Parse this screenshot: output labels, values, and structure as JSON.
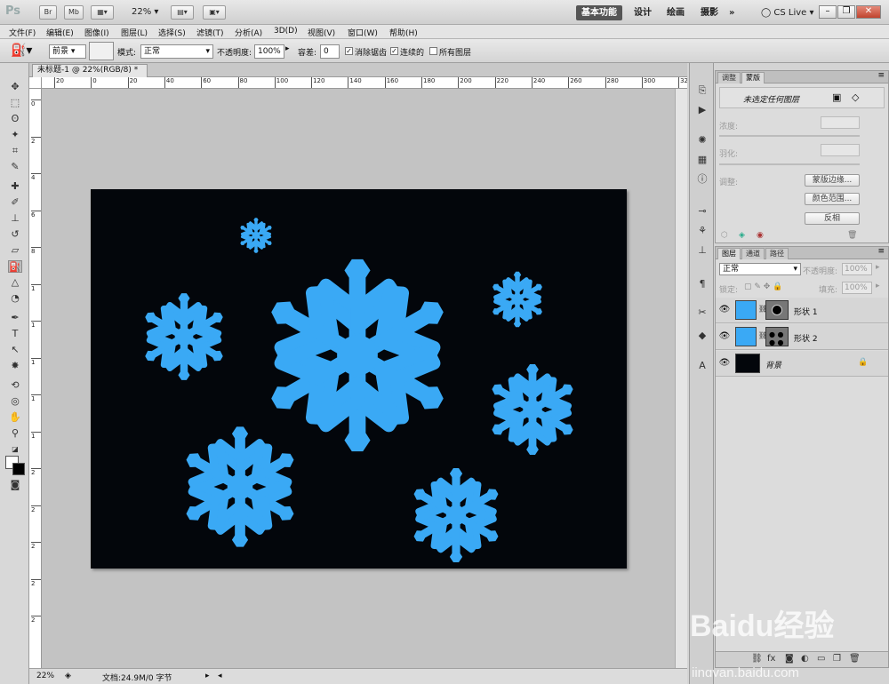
{
  "titlebar": {
    "app_logo": "Ps",
    "br_btn": "Br",
    "mb_btn": "Mb",
    "zoom": "22%",
    "workspaces": [
      "基本功能",
      "设计",
      "绘画",
      "摄影",
      "»"
    ],
    "cs_live": "CS Live",
    "window_controls": [
      "–",
      "❐",
      "✕"
    ]
  },
  "menu": [
    "文件(F)",
    "编辑(E)",
    "图像(I)",
    "图层(L)",
    "选择(S)",
    "滤镜(T)",
    "分析(A)",
    "3D(D)",
    "视图(V)",
    "窗口(W)",
    "帮助(H)"
  ],
  "options": {
    "fill_source": "前景",
    "mode_label": "模式:",
    "mode_value": "正常",
    "opacity_label": "不透明度:",
    "opacity_value": "100%",
    "tolerance_label": "容差:",
    "tolerance_value": "0",
    "antialias_label": "消除锯齿",
    "contiguous_label": "连续的",
    "all_layers_label": "所有图层"
  },
  "document": {
    "tab_title": "未标题-1 @ 22%(RGB/8) *",
    "ruler_top_labels": [
      "20",
      "0",
      "20",
      "40",
      "60",
      "80",
      "100",
      "120",
      "140",
      "160",
      "180",
      "200",
      "220",
      "240",
      "260",
      "280",
      "300",
      "32"
    ],
    "ruler_left_labels": [
      "0",
      "2",
      "4",
      "6",
      "8",
      "1",
      "1",
      "1",
      "1",
      "1",
      "2",
      "2",
      "2",
      "2",
      "2"
    ],
    "zoom": "22%",
    "doc_info": "文档:24.9M/0 字节"
  },
  "masks_panel": {
    "tabs": [
      "调整",
      "蒙版"
    ],
    "title": "未选定任何图层",
    "density_label": "浓度:",
    "feather_label": "羽化:",
    "refine_label": "调整:",
    "buttons": [
      "蒙版边缘...",
      "颜色范围...",
      "反相"
    ]
  },
  "layers_panel": {
    "tabs": [
      "图层",
      "通道",
      "路径"
    ],
    "blend_mode": "正常",
    "opacity_label": "不透明度:",
    "opacity_value": "100%",
    "lock_label": "锁定:",
    "fill_label": "填充:",
    "fill_value": "100%",
    "layers": [
      {
        "name": "形状 1",
        "thumb_color": "#3aa9f5"
      },
      {
        "name": "形状 2",
        "thumb_color": "#3aa9f5"
      },
      {
        "name": "背景",
        "thumb_color": "#03060b"
      }
    ]
  },
  "colors": {
    "snowflake": "#3aa9f5",
    "canvas_bg": "#03060b",
    "pasteboard": "#c3c3c3"
  },
  "watermark": {
    "text": "Baidu经验",
    "subtext": "jingyan.baidu.com"
  }
}
